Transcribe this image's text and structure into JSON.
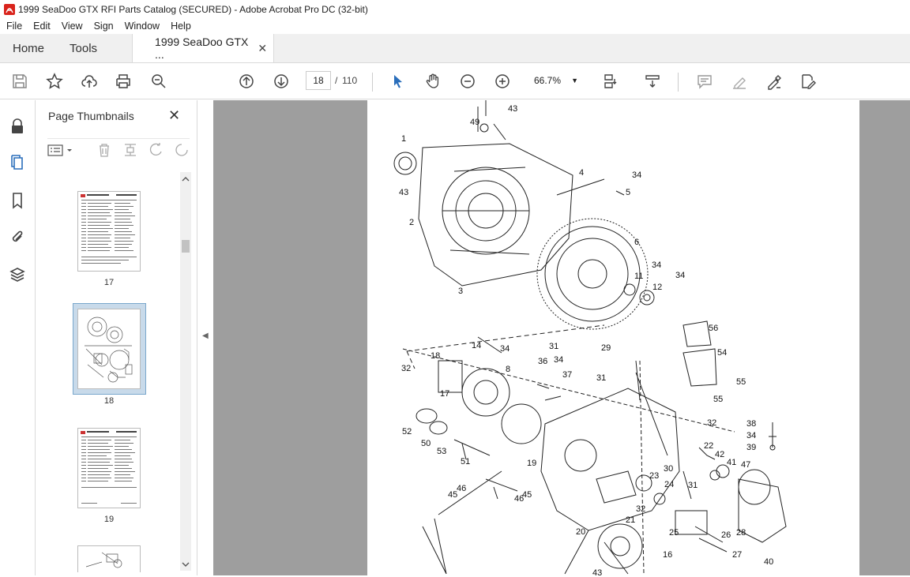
{
  "window": {
    "title": "1999 SeaDoo GTX RFI Parts Catalog (SECURED) - Adobe Acrobat Pro DC (32-bit)"
  },
  "menu": [
    "File",
    "Edit",
    "View",
    "Sign",
    "Window",
    "Help"
  ],
  "tabs": {
    "home": "Home",
    "tools": "Tools",
    "document": "1999 SeaDoo GTX ..."
  },
  "toolbar": {
    "page_current": "18",
    "page_separator": "/",
    "page_total": "110",
    "zoom": "66.7%"
  },
  "panel": {
    "title": "Page Thumbnails",
    "thumbnails": [
      {
        "label": "17"
      },
      {
        "label": "18",
        "selected": true
      },
      {
        "label": "19"
      }
    ]
  },
  "diagram": {
    "callouts": [
      "1",
      "43",
      "49",
      "43",
      "2",
      "4",
      "34",
      "5",
      "6",
      "34",
      "11",
      "12",
      "34",
      "3",
      "56",
      "54",
      "55",
      "55",
      "29",
      "31",
      "31",
      "18",
      "14",
      "34",
      "32",
      "8",
      "36",
      "34",
      "37",
      "17",
      "52",
      "50",
      "53",
      "51",
      "19",
      "32",
      "22",
      "42",
      "41",
      "47",
      "38",
      "34",
      "39",
      "23",
      "30",
      "24",
      "31",
      "46",
      "45",
      "45",
      "46",
      "21",
      "20",
      "32",
      "25",
      "26",
      "28",
      "27",
      "16",
      "40",
      "43"
    ]
  }
}
